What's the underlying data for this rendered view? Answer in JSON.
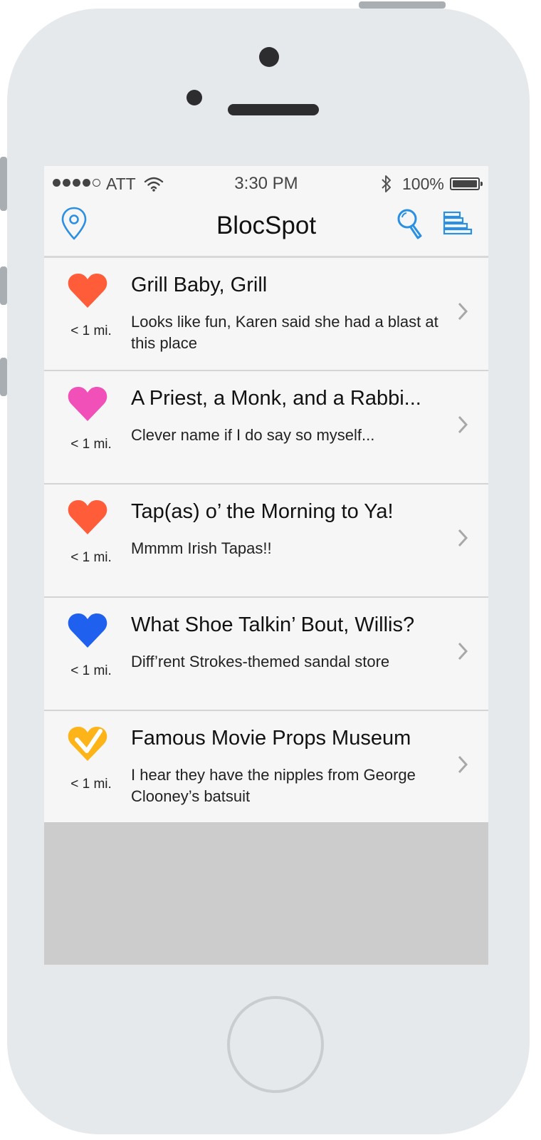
{
  "status_bar": {
    "carrier": "ATT",
    "time": "3:30 PM",
    "battery": "100%",
    "signal_bars_filled": 4,
    "signal_bars_total": 5
  },
  "nav": {
    "title": "BlocSpot",
    "left_icon": "map-pin-icon",
    "right_icons": [
      "search-icon",
      "list-icon"
    ],
    "accent_color": "#2b8fe2"
  },
  "spots": [
    {
      "title": "Grill Baby, Grill",
      "description": "Looks like fun, Karen said she had a blast at this place",
      "distance": "< 1 mi.",
      "icon": "heart-icon",
      "color": "#ff5c3a"
    },
    {
      "title": "A Priest, a Monk, and a Rabbi...",
      "description": "Clever name if I do say so myself...",
      "distance": "< 1 mi.",
      "icon": "heart-icon",
      "color": "#f050b8"
    },
    {
      "title": "Tap(as) o’ the Morning to Ya!",
      "description": "Mmmm Irish Tapas!!",
      "distance": "< 1 mi.",
      "icon": "heart-icon",
      "color": "#ff5c3a"
    },
    {
      "title": "What Shoe Talkin’ Bout, Willis?",
      "description": "Diff’rent Strokes-themed sandal store",
      "distance": "< 1 mi.",
      "icon": "heart-icon",
      "color": "#1f60ee"
    },
    {
      "title": "Famous Movie Props Museum",
      "description": "I hear they have the nipples from George Clooney’s batsuit",
      "distance": "< 1 mi.",
      "icon": "visited-heart-icon",
      "color": "#fdb419"
    }
  ]
}
